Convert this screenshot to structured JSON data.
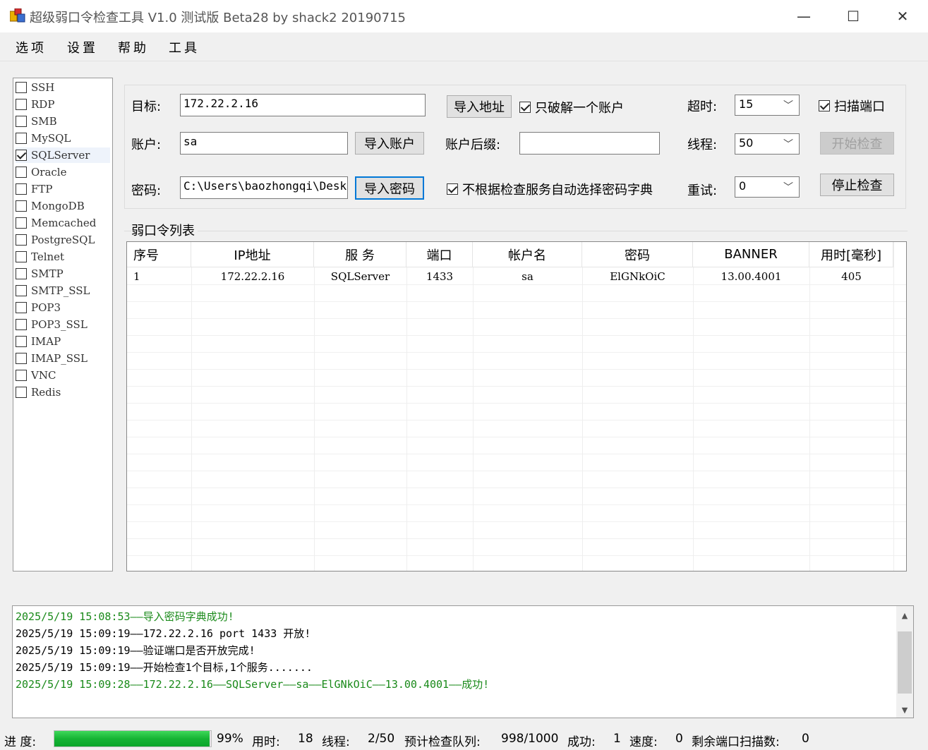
{
  "window": {
    "title": "超级弱口令检查工具 V1.0 测试版 Beta28 by shack2 20190715",
    "minimize": "—",
    "maximize": "☐",
    "close": "✕"
  },
  "menu": [
    "选项",
    "设置",
    "帮助",
    "工具"
  ],
  "services": [
    {
      "label": "SSH",
      "checked": false
    },
    {
      "label": "RDP",
      "checked": false
    },
    {
      "label": "SMB",
      "checked": false
    },
    {
      "label": "MySQL",
      "checked": false
    },
    {
      "label": "SQLServer",
      "checked": true
    },
    {
      "label": "Oracle",
      "checked": false
    },
    {
      "label": "FTP",
      "checked": false
    },
    {
      "label": "MongoDB",
      "checked": false
    },
    {
      "label": "Memcached",
      "checked": false
    },
    {
      "label": "PostgreSQL",
      "checked": false
    },
    {
      "label": "Telnet",
      "checked": false
    },
    {
      "label": "SMTP",
      "checked": false
    },
    {
      "label": "SMTP_SSL",
      "checked": false
    },
    {
      "label": "POP3",
      "checked": false
    },
    {
      "label": "POP3_SSL",
      "checked": false
    },
    {
      "label": "IMAP",
      "checked": false
    },
    {
      "label": "IMAP_SSL",
      "checked": false
    },
    {
      "label": "VNC",
      "checked": false
    },
    {
      "label": "Redis",
      "checked": false
    }
  ],
  "config": {
    "target_label": "目标:",
    "target_value": "172.22.2.16",
    "import_address": "导入地址",
    "crack_one_label": "只破解一个账户",
    "crack_one_checked": true,
    "account_label": "账户:",
    "account_value": "sa",
    "import_account": "导入账户",
    "suffix_label": "账户后缀:",
    "suffix_value": "",
    "password_label": "密码:",
    "password_value": "C:\\Users\\baozhongqi\\Deskt",
    "import_password": "导入密码",
    "auto_dict_label": "不根据检查服务自动选择密码字典",
    "auto_dict_checked": true,
    "timeout_label": "超时:",
    "timeout_value": "15",
    "threads_label": "线程:",
    "threads_value": "50",
    "retry_label": "重试:",
    "retry_value": "0",
    "scan_port_label": "扫描端口",
    "scan_port_checked": true,
    "start_check": "开始检查",
    "stop_check": "停止检查"
  },
  "results": {
    "group_title": "弱口令列表",
    "columns": [
      "序号",
      "IP地址",
      "服 务",
      "端口",
      "帐户名",
      "密码",
      "BANNER",
      "用时[毫秒]"
    ],
    "rows": [
      [
        "1",
        "172.22.2.16",
        "SQLServer",
        "1433",
        "sa",
        "ElGNkOiC",
        "13.00.4001",
        "405"
      ]
    ]
  },
  "log": [
    {
      "text": "2025/5/19 15:08:53——导入密码字典成功!",
      "color": "#1a8a1a"
    },
    {
      "text": "2025/5/19 15:09:19——172.22.2.16 port 1433 开放!",
      "color": "#000000"
    },
    {
      "text": "2025/5/19 15:09:19——验证端口是否开放完成!",
      "color": "#000000"
    },
    {
      "text": "2025/5/19 15:09:19——开始检查1个目标,1个服务.......",
      "color": "#000000"
    },
    {
      "text": "2025/5/19 15:09:28——172.22.2.16——SQLServer——sa——ElGNkOiC——13.00.4001——成功!",
      "color": "#1a8a1a"
    }
  ],
  "status": {
    "progress_label": "进 度:",
    "progress_percent": 99,
    "progress_text": "99%",
    "elapsed_label": "用时:",
    "elapsed_value": "18",
    "threads_label": "线程:",
    "threads_value": "2/50",
    "queue_label": "预计检查队列:",
    "queue_value": "998/1000",
    "success_label": "成功:",
    "success_value": "1",
    "speed_label": "速度:",
    "speed_value": "0",
    "remaining_label": "剩余端口扫描数:",
    "remaining_value": "0"
  }
}
